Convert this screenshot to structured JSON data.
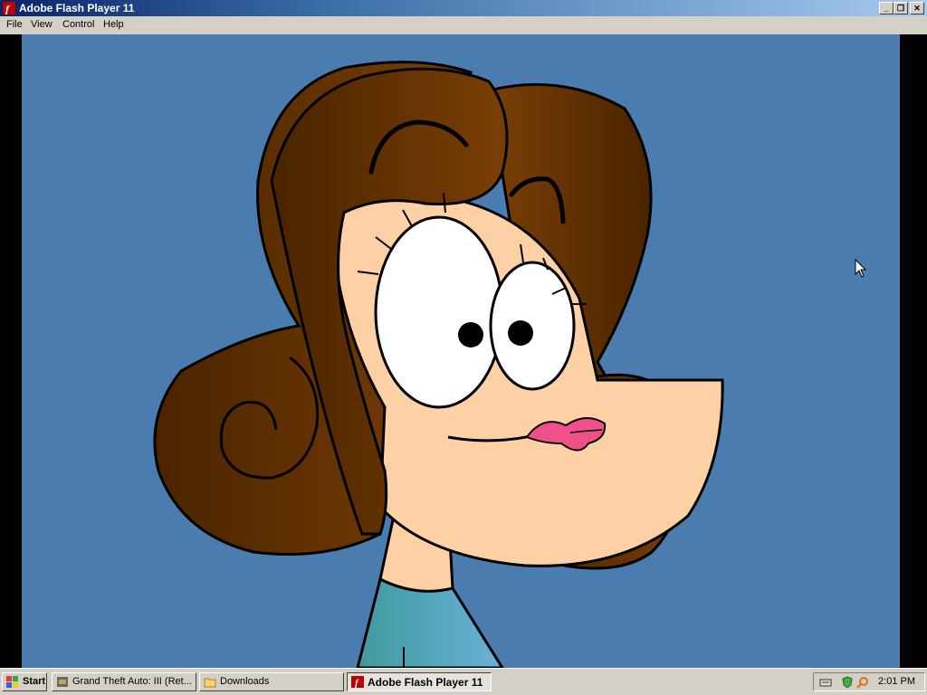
{
  "window": {
    "title": "Adobe Flash Player 11",
    "minimize_glyph": "_",
    "restore_glyph": "❐",
    "close_glyph": "✕"
  },
  "menu": {
    "items": [
      "File",
      "View",
      "Control",
      "Help"
    ]
  },
  "stage": {
    "background": "#4a7cb0",
    "content": "cartoon-woman-face"
  },
  "taskbar": {
    "start_label": "Start",
    "tasks": [
      {
        "label": "Grand Theft Auto: III (Ret...",
        "icon": "gta-icon",
        "active": false
      },
      {
        "label": "Downloads",
        "icon": "folder-icon",
        "active": false
      },
      {
        "label": "Adobe Flash Player 11",
        "icon": "flash-icon",
        "active": true
      }
    ],
    "clock": "2:01 PM"
  },
  "colors": {
    "hair_dark": "#4a2400",
    "hair_light": "#7a3f05",
    "skin": "#fdd0a6",
    "lips": "#f0508a",
    "shirt": "#5fa8c8"
  }
}
